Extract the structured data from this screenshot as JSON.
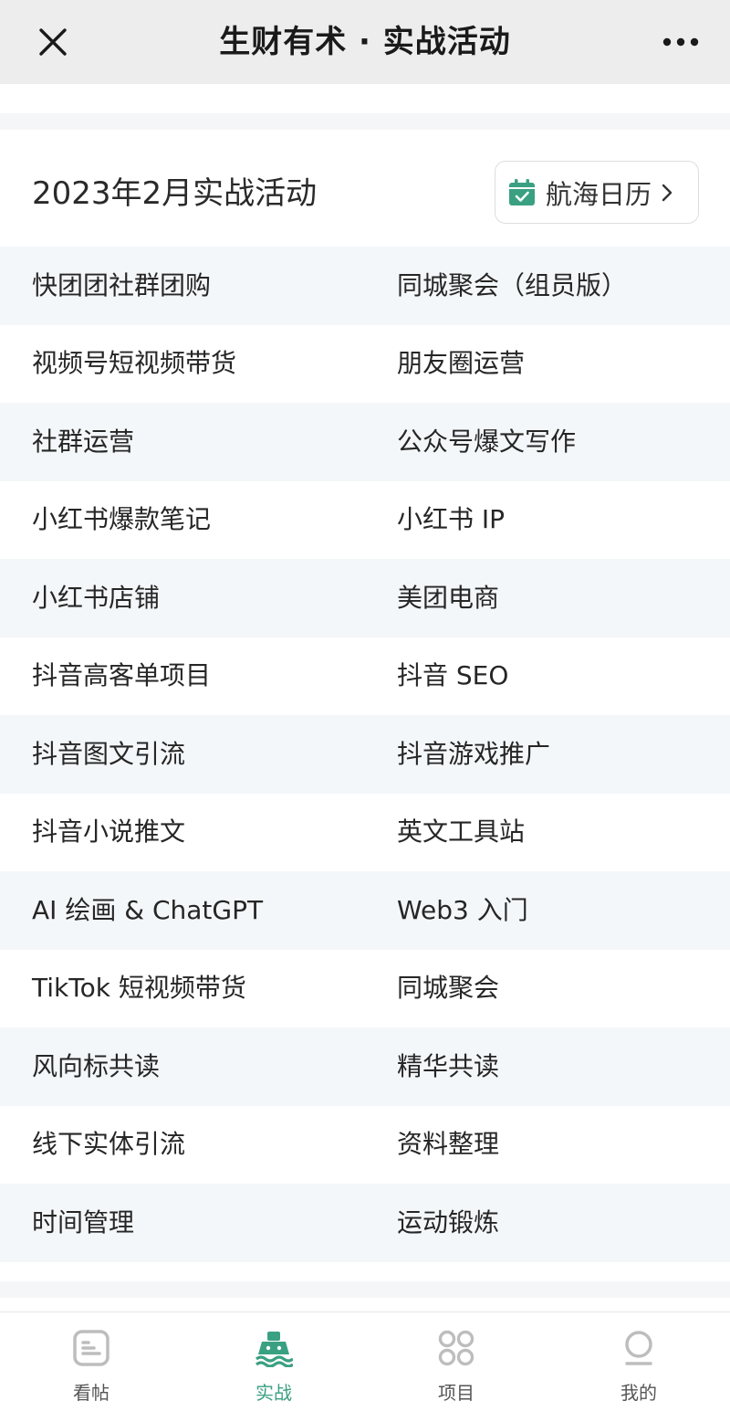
{
  "header": {
    "title": "生财有术 · 实战活动",
    "close_icon": "close-icon",
    "more_icon": "more-dots-icon"
  },
  "section": {
    "title": "2023年2月实战活动",
    "calendar_button": {
      "label": "航海日历",
      "icon": "calendar-check-icon"
    }
  },
  "activities": [
    [
      "快团团社群团购",
      "同城聚会（组员版）"
    ],
    [
      "视频号短视频带货",
      "朋友圈运营"
    ],
    [
      "社群运营",
      "公众号爆文写作"
    ],
    [
      "小红书爆款笔记",
      "小红书 IP"
    ],
    [
      "小红书店铺",
      "美团电商"
    ],
    [
      "抖音高客单项目",
      "抖音 SEO"
    ],
    [
      "抖音图文引流",
      "抖音游戏推广"
    ],
    [
      "抖音小说推文",
      "英文工具站"
    ],
    [
      "AI 绘画 & ChatGPT",
      "Web3 入门"
    ],
    [
      "TikTok 短视频带货",
      "同城聚会"
    ],
    [
      "风向标共读",
      "精华共读"
    ],
    [
      "线下实体引流",
      "资料整理"
    ],
    [
      "时间管理",
      "运动锻炼"
    ]
  ],
  "tabs": [
    {
      "label": "看帖",
      "icon": "posts-icon",
      "active": false
    },
    {
      "label": "实战",
      "icon": "ship-icon",
      "active": true
    },
    {
      "label": "项目",
      "icon": "grid-circles-icon",
      "active": false
    },
    {
      "label": "我的",
      "icon": "profile-icon",
      "active": false
    }
  ],
  "colors": {
    "accent": "#3aa082",
    "header_bg": "#ededed",
    "row_alt_bg": "#f4f7f9",
    "inactive_icon": "#bdbdbd"
  }
}
